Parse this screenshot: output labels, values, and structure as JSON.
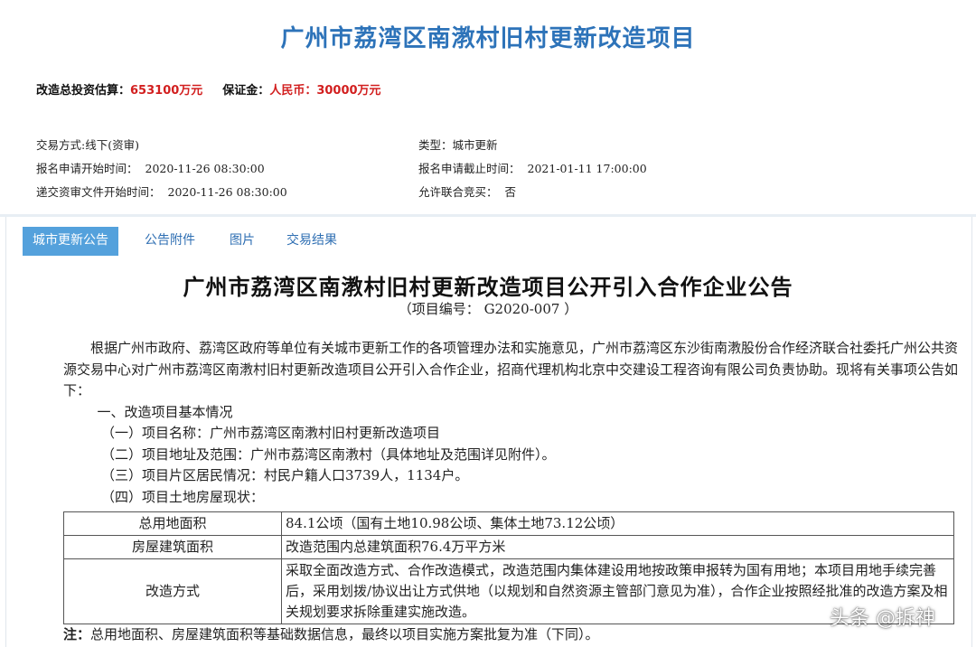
{
  "project_title": "广州市荔湾区南漖村旧村更新改造项目",
  "summary": {
    "investment_label": "改造总投资估算：",
    "investment_value": "653100万元",
    "deposit_label": "保证金：",
    "deposit_value": "人民币：30000万元"
  },
  "info": {
    "trade_method": "交易方式:线下(资审)",
    "type_label": "类型：",
    "type_value": "城市更新",
    "apply_start_label": "报名申请开始时间：",
    "apply_start_value": "2020-11-26 08:30:00",
    "apply_end_label": "报名申请截止时间：",
    "apply_end_value": "2021-01-11 17:00:00",
    "submit_start_label": "递交资审文件开始时间：",
    "submit_start_value": "2020-11-26 08:30:00",
    "joint_label": "允许联合竞买：",
    "joint_value": "否"
  },
  "tabs": [
    {
      "label": "城市更新公告",
      "active": true
    },
    {
      "label": "公告附件",
      "active": false
    },
    {
      "label": "图片",
      "active": false
    },
    {
      "label": "交易结果",
      "active": false
    }
  ],
  "announcement": {
    "title": "广州市荔湾区南漖村旧村更新改造项目公开引入合作企业公告",
    "number": "（项目编号： G2020-007 ）",
    "intro": "根据广州市政府、荔湾区政府等单位有关城市更新工作的各项管理办法和实施意见，广州市荔湾区东沙街南漖股份合作经济联合社委托广州公共资源交易中心对广州市荔湾区南漖村旧村更新改造项目公开引入合作企业，招商代理机构北京中交建设工程咨询有限公司负责协助。现将有关事项公告如下：",
    "section1": "一、改造项目基本情况",
    "item1": "（一）项目名称：广州市荔湾区南漖村旧村更新改造项目",
    "item2": "（二）项目地址及范围：广州市荔湾区南漖村（具体地址及范围详见附件）。",
    "item3": "（三）项目片区居民情况：村民户籍人口3739人，1134户。",
    "item4": "（四）项目土地房屋现状：",
    "table": [
      {
        "key": "总用地面积",
        "value": "84.1公顷（国有土地10.98公顷、集体土地73.12公顷）"
      },
      {
        "key": "房屋建筑面积",
        "value": "改造范围内总建筑面积76.4万平方米"
      },
      {
        "key": "改造方式",
        "value": "采取全面改造方式、合作改造模式，改造范围内集体建设用地按政策申报转为国有用地；本项目用地手续完善后，采用划拨/协议出让方式供地（以规划和自然资源主管部门意见为准），合作企业按照经批准的改造方案及相关规划要求拆除重建实施改造。"
      }
    ],
    "note_label": "注：",
    "note_text": "总用地面积、房屋建筑面积等基础数据信息，最终以项目实施方案批复为准（下同）。"
  },
  "watermark": "头条 @拆神",
  "colors": {
    "title_blue": "#2d73b9",
    "accent_red": "#d21f1f",
    "tab_active_bg": "#54a1dc"
  }
}
